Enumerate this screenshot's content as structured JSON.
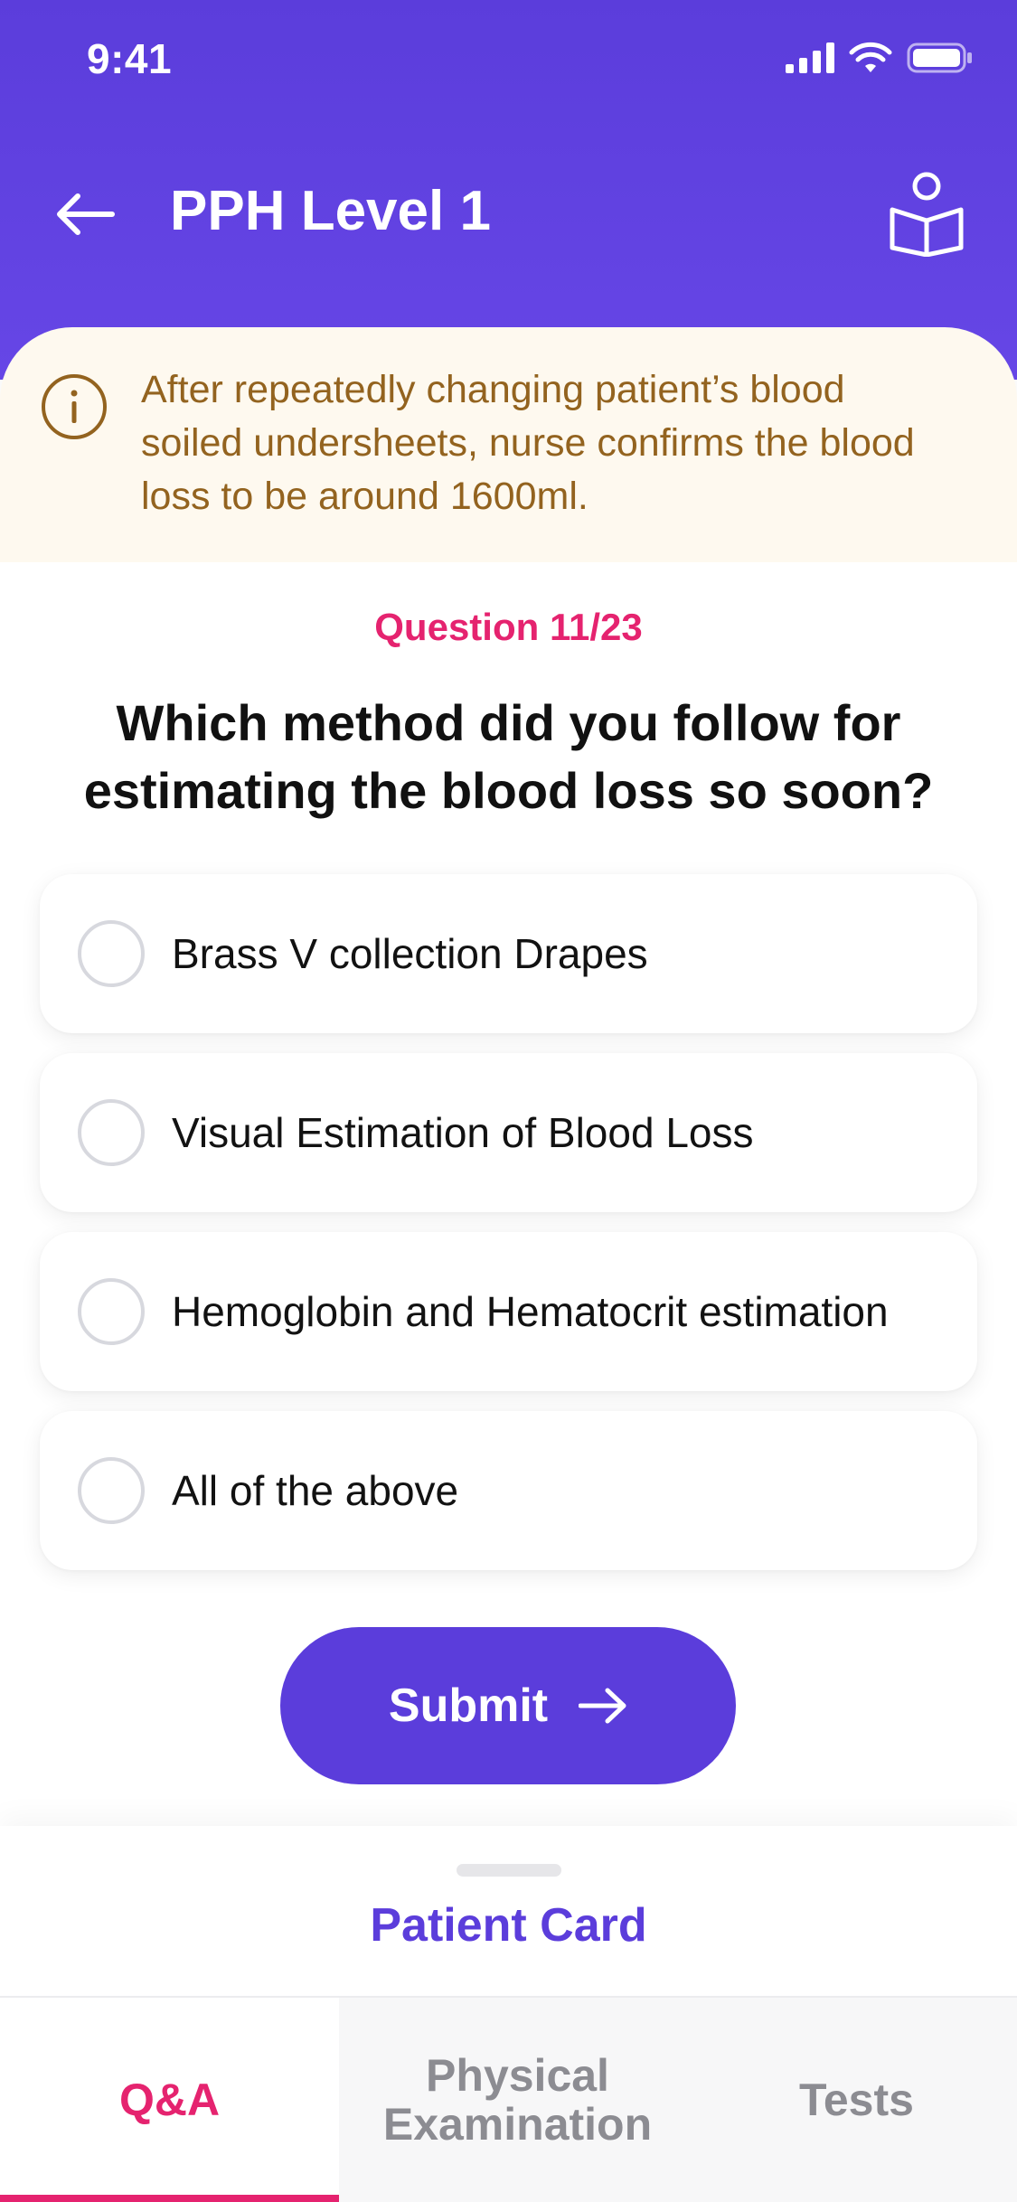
{
  "status_bar": {
    "time": "9:41"
  },
  "header": {
    "title": "PPH Level 1"
  },
  "info": {
    "text": "After repeatedly changing patient’s blood soiled undersheets, nurse confirms the blood loss to be around 1600ml."
  },
  "question": {
    "counter": "Question 11/23",
    "text": "Which method did you follow for estimating the blood loss so soon?",
    "options": [
      {
        "label": "Brass V collection Drapes"
      },
      {
        "label": "Visual Estimation of Blood Loss"
      },
      {
        "label": "Hemoglobin and Hematocrit estimation"
      },
      {
        "label": "All of the above"
      }
    ]
  },
  "submit": {
    "label": "Submit"
  },
  "sheet": {
    "title": "Patient Card",
    "tabs": {
      "qa": "Q&A",
      "physical": "Physical Examination",
      "tests": "Tests"
    }
  },
  "colors": {
    "brand": "#5b3ddb",
    "accent": "#e5236f",
    "info_text": "#93631f",
    "info_bg": "#fef9ef"
  },
  "icons": {
    "back": "arrow-left-icon",
    "book": "reading-person-icon",
    "info": "info-icon",
    "submit": "arrow-right-icon"
  }
}
